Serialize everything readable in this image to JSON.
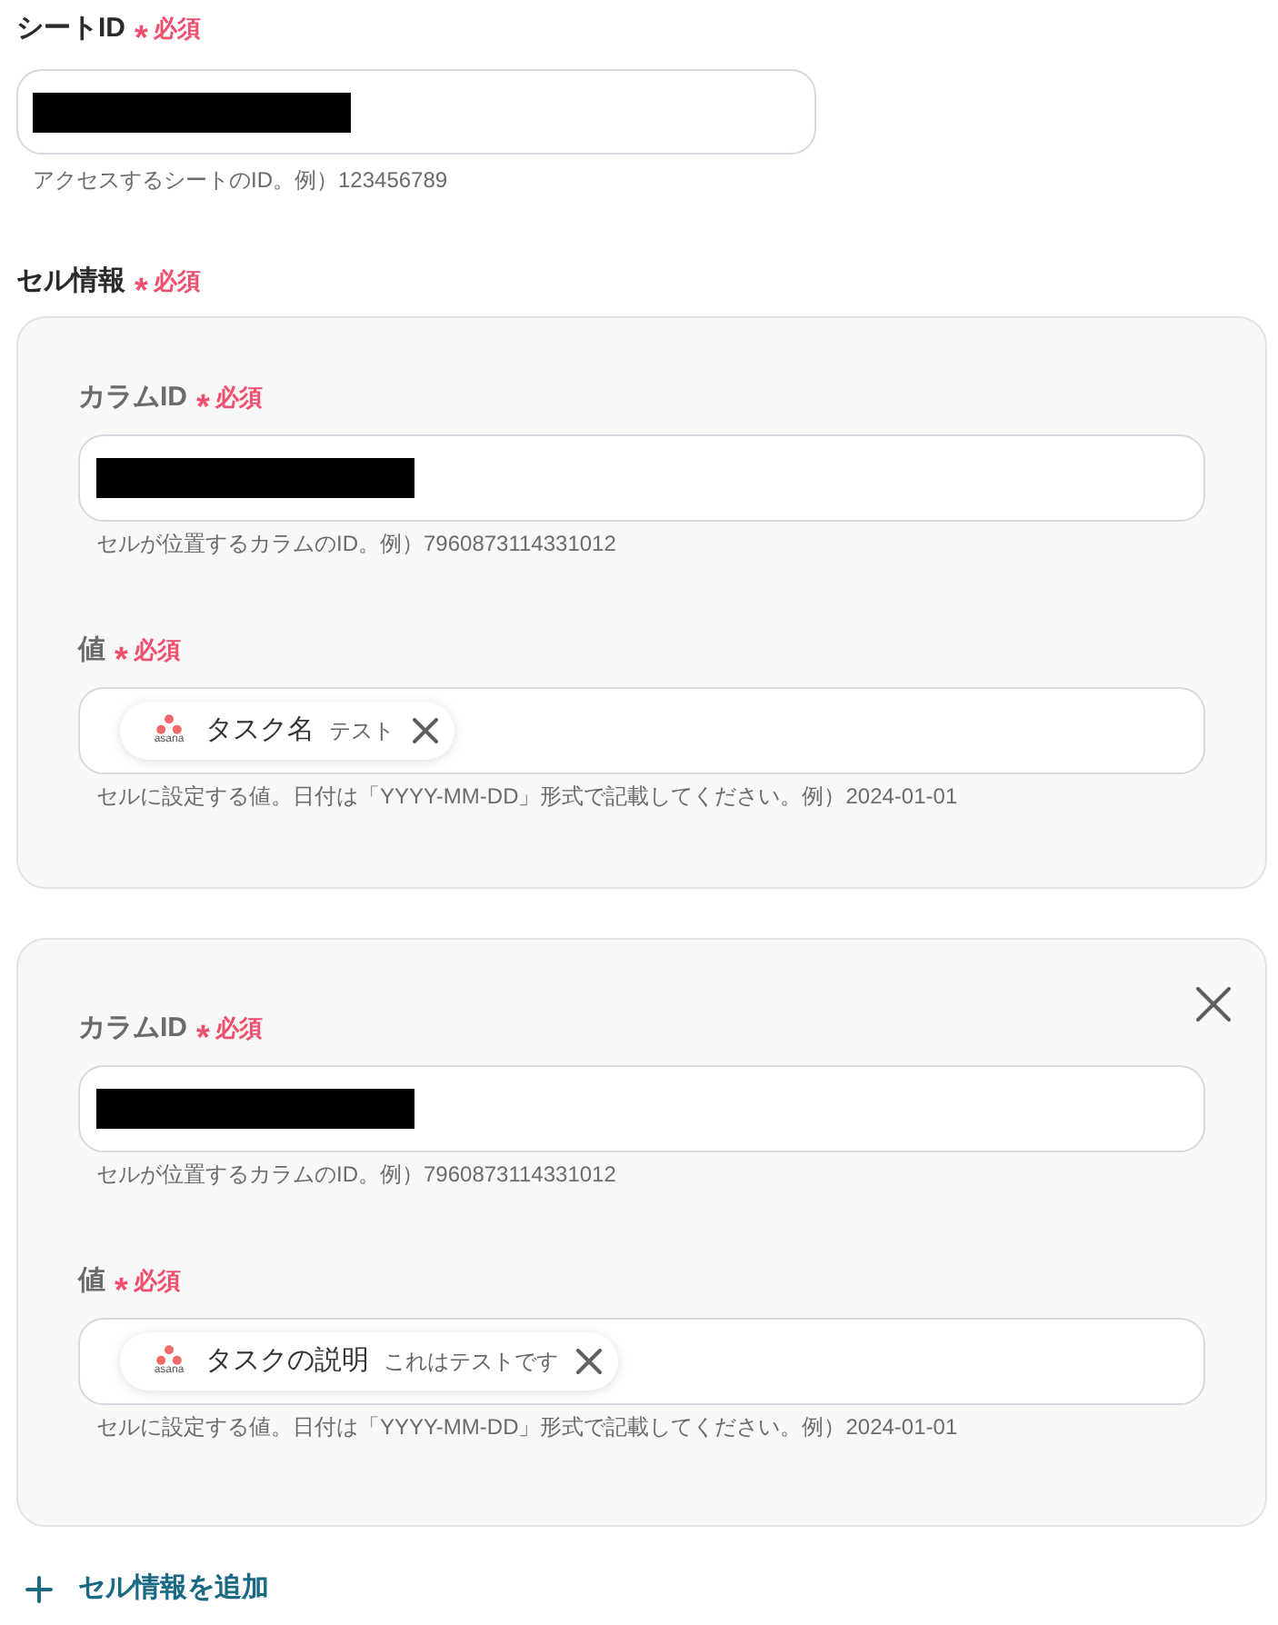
{
  "sheet_id": {
    "label": "シートID",
    "required_mark": "*",
    "required_text": "必須",
    "redacted": true,
    "help": "アクセスするシートのID。例）123456789"
  },
  "cell_info": {
    "label": "セル情報",
    "required_mark": "*",
    "required_text": "必須",
    "groups": [
      {
        "removable": false,
        "fields": [
          {
            "kind": "text",
            "label": "カラムID",
            "required_mark": "*",
            "required_text": "必須",
            "redacted": true,
            "help": "セルが位置するカラムのID。例）7960873114331012"
          },
          {
            "kind": "chips",
            "label": "値",
            "required_mark": "*",
            "required_text": "必須",
            "chips": [
              {
                "logo_text": "asana",
                "name": "タスク名",
                "sample": "テスト"
              }
            ],
            "help": "セルに設定する値。日付は「YYYY-MM-DD」形式で記載してください。例）2024-01-01"
          }
        ]
      },
      {
        "removable": true,
        "fields": [
          {
            "kind": "text",
            "label": "カラムID",
            "required_mark": "*",
            "required_text": "必須",
            "redacted": true,
            "help": "セルが位置するカラムのID。例）7960873114331012"
          },
          {
            "kind": "chips",
            "label": "値",
            "required_mark": "*",
            "required_text": "必須",
            "chips": [
              {
                "logo_text": "asana",
                "name": "タスクの説明",
                "sample": "これはテストです"
              }
            ],
            "help": "セルに設定する値。日付は「YYYY-MM-DD」形式で記載してください。例）2024-01-01"
          }
        ]
      }
    ]
  },
  "add_button": {
    "label": "セル情報を追加"
  }
}
